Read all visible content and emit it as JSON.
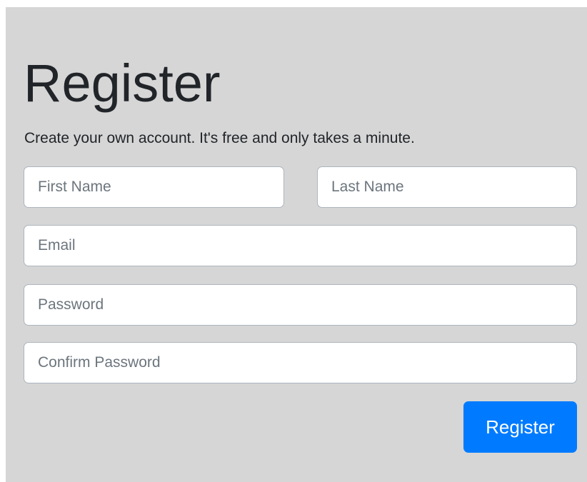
{
  "form": {
    "title": "Register",
    "subtitle": "Create your own account. It's free and only takes a minute.",
    "fields": {
      "first_name": {
        "placeholder": "First Name",
        "value": ""
      },
      "last_name": {
        "placeholder": "Last Name",
        "value": ""
      },
      "email": {
        "placeholder": "Email",
        "value": ""
      },
      "password": {
        "placeholder": "Password",
        "value": ""
      },
      "confirm_password": {
        "placeholder": "Confirm Password",
        "value": ""
      }
    },
    "submit_label": "Register"
  },
  "colors": {
    "panel_background": "#d6d6d6",
    "primary_button": "#007bff",
    "text": "#212529",
    "input_border": "#adb5bd"
  }
}
